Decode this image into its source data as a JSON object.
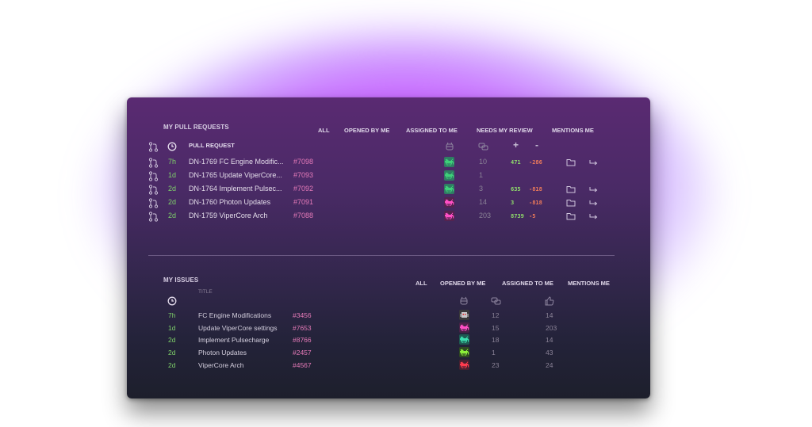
{
  "pull_requests": {
    "title": "MY PULL REQUESTS",
    "filters": [
      "ALL",
      "OPENED BY ME",
      "ASSIGNED TO ME",
      "NEEDS MY REVIEW",
      "MENTIONS ME"
    ],
    "column_pr": "PULL REQUEST",
    "plus": "+",
    "minus": "-",
    "rows": [
      {
        "age": "7h",
        "title": "DN-1769 FC Engine Modific...",
        "number": "#7098",
        "comments": "10",
        "added": "471",
        "removed": "-286",
        "avatar_icon": "space-invader-green-icon",
        "avatar_color": "#3fcf7a",
        "avatar_bg": "#2f7d63"
      },
      {
        "age": "1d",
        "title": "DN-1765 Update ViperCore...",
        "number": "#7093",
        "comments": "1",
        "added": "",
        "removed": "",
        "avatar_icon": "space-invader-green-icon",
        "avatar_color": "#3fcf7a",
        "avatar_bg": "#2f7d63"
      },
      {
        "age": "2d",
        "title": "DN-1764 Implement Pulsec...",
        "number": "#7092",
        "comments": "3",
        "added": "635",
        "removed": "-818",
        "avatar_icon": "space-invader-green-icon",
        "avatar_color": "#3fcf7a",
        "avatar_bg": "#2f7d63"
      },
      {
        "age": "2d",
        "title": "DN-1760 Photon Updates",
        "number": "#7091",
        "comments": "14",
        "added": "3",
        "removed": "-818",
        "avatar_icon": "space-invader-pink-icon",
        "avatar_color": "#ff4fc6",
        "avatar_bg": "#55234f"
      },
      {
        "age": "2d",
        "title": "DN-1759 ViperCore Arch",
        "number": "#7088",
        "comments": "203",
        "added": "8739",
        "removed": "-5",
        "avatar_icon": "space-invader-pink-icon",
        "avatar_color": "#ff4fc6",
        "avatar_bg": "#55234f"
      }
    ]
  },
  "issues": {
    "title": "MY ISSUES",
    "filters": [
      "ALL",
      "OPENED BY ME",
      "ASSIGNED TO ME",
      "MENTIONS ME"
    ],
    "column_title": "TITLE",
    "rows": [
      {
        "age": "7h",
        "title": "FC Engine Modifications",
        "number": "#3456",
        "comments": "12",
        "likes": "14",
        "avatar_icon": "robot-avatar-icon",
        "avatar_color": "#c9c9c9",
        "avatar_bg": "#3a3a3a"
      },
      {
        "age": "1d",
        "title": "Update ViperCore settings",
        "number": "#7653",
        "comments": "15",
        "likes": "203",
        "avatar_icon": "space-invader-pink-icon",
        "avatar_color": "#ff4fc6",
        "avatar_bg": "#4a2347"
      },
      {
        "age": "2d",
        "title": "Implement Pulsecharge",
        "number": "#8766",
        "comments": "18",
        "likes": "14",
        "avatar_icon": "space-invader-teal-icon",
        "avatar_color": "#3de0b0",
        "avatar_bg": "#1e5a52"
      },
      {
        "age": "2d",
        "title": "Photon Updates",
        "number": "#2457",
        "comments": "1",
        "likes": "43",
        "avatar_icon": "space-invader-lime-icon",
        "avatar_color": "#8cf03a",
        "avatar_bg": "#2f4a22"
      },
      {
        "age": "2d",
        "title": "ViperCore Arch",
        "number": "#4567",
        "comments": "23",
        "likes": "24",
        "avatar_icon": "space-invader-red-icon",
        "avatar_color": "#ff3b4e",
        "avatar_bg": "#4a2030"
      }
    ]
  }
}
